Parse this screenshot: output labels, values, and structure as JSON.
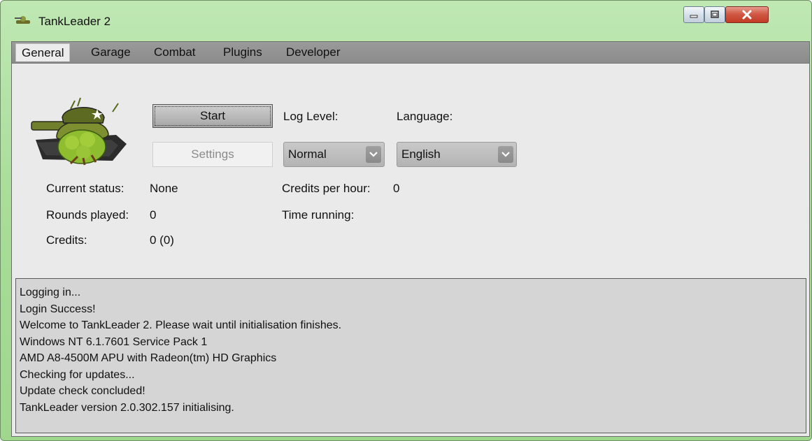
{
  "window": {
    "title": "TankLeader 2",
    "controls": {
      "minimize": "minimize-icon",
      "maximize": "maximize-icon",
      "close": "close-icon"
    }
  },
  "tabs": [
    "General",
    "Garage",
    "Combat",
    "Plugins",
    "Developer"
  ],
  "active_tab": "General",
  "general": {
    "start_label": "Start",
    "settings_label": "Settings",
    "log_level_label": "Log Level:",
    "log_level_value": "Normal",
    "language_label": "Language:",
    "language_value": "English",
    "status_label": "Current status:",
    "status_value": "None",
    "rounds_label": "Rounds played:",
    "rounds_value": "0",
    "credits_label": "Credits:",
    "credits_value": "0 (0)",
    "cph_label": "Credits per hour:",
    "cph_value": "0",
    "time_label": "Time running:"
  },
  "log": [
    "Logging in...",
    "Login Success!",
    "Welcome to TankLeader 2. Please wait until initialisation finishes.",
    "Windows NT 6.1.7601 Service Pack 1",
    "AMD A8-4500M APU with Radeon(tm) HD Graphics",
    "Checking for updates...",
    "Update check concluded!",
    "TankLeader version 2.0.302.157 initialising."
  ],
  "colors": {
    "title_bar": "#a9dd98",
    "client_bg": "#eaeaea",
    "tab_bar": "#8f8f8f",
    "log_bg": "#d5d5d5",
    "close_button": "#c94a33"
  }
}
